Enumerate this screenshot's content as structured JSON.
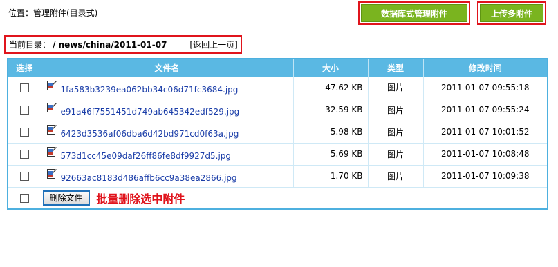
{
  "location": "位置：管理附件(目录式)",
  "buttons": {
    "db_manage": "数据库式管理附件",
    "upload_multi": "上传多附件"
  },
  "current_dir": {
    "label": "当前目录：",
    "path": "/ news/china/2011-01-07",
    "back": "[返回上一页]"
  },
  "table": {
    "headers": {
      "select": "选择",
      "filename": "文件名",
      "size": "大小",
      "type": "类型",
      "modified": "修改时间"
    },
    "rows": [
      {
        "name": "1fa583b3239ea062bb34c06d71fc3684.jpg",
        "size": "47.62 KB",
        "type": "图片",
        "time": "2011-01-07 09:55:18"
      },
      {
        "name": "e91a46f7551451d749ab645342edf529.jpg",
        "size": "32.59 KB",
        "type": "图片",
        "time": "2011-01-07 09:55:24"
      },
      {
        "name": "6423d3536af06dba6d42bd971cd0f63a.jpg",
        "size": "5.98 KB",
        "type": "图片",
        "time": "2011-01-07 10:01:52"
      },
      {
        "name": "573d1cc45e09daf26ff86fe8df9927d5.jpg",
        "size": "5.69 KB",
        "type": "图片",
        "time": "2011-01-07 10:08:48"
      },
      {
        "name": "92663ac8183d486affb6cc9a38ea2866.jpg",
        "size": "1.70 KB",
        "type": "图片",
        "time": "2011-01-07 10:09:38"
      }
    ],
    "delete_button": "删除文件",
    "batch_note": "批量删除选中附件"
  },
  "icons": {
    "file": "image-file-icon",
    "checkbox": "checkbox-icon"
  },
  "colors": {
    "green_button": "#7ab41f",
    "header_blue": "#5ab8e3",
    "highlight_red": "#e0141c",
    "link_blue": "#1a3da8"
  }
}
